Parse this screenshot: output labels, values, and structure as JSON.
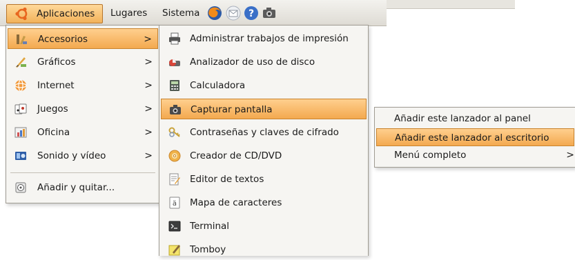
{
  "panel": {
    "menus": [
      {
        "label": "Aplicaciones"
      },
      {
        "label": "Lugares"
      },
      {
        "label": "Sistema"
      }
    ],
    "launchers": [
      "firefox-icon",
      "mail-icon",
      "help-icon",
      "screenshot-icon"
    ]
  },
  "main_menu": {
    "items": [
      {
        "label": "Accesorios",
        "icon": "accessories-icon",
        "arrow": ">"
      },
      {
        "label": "Gráficos",
        "icon": "graphics-icon",
        "arrow": ">"
      },
      {
        "label": "Internet",
        "icon": "internet-icon",
        "arrow": ">"
      },
      {
        "label": "Juegos",
        "icon": "games-icon",
        "arrow": ">"
      },
      {
        "label": "Oficina",
        "icon": "office-icon",
        "arrow": ">"
      },
      {
        "label": "Sonido y vídeo",
        "icon": "sound-video-icon",
        "arrow": ">"
      },
      {
        "label": "Añadir y quitar...",
        "icon": "add-remove-icon"
      }
    ]
  },
  "accessories_menu": {
    "items": [
      {
        "label": "Administrar trabajos de impresión",
        "icon": "printer-icon"
      },
      {
        "label": "Analizador de uso de disco",
        "icon": "disk-usage-icon"
      },
      {
        "label": "Calculadora",
        "icon": "calculator-icon"
      },
      {
        "label": "Capturar pantalla",
        "icon": "camera-icon"
      },
      {
        "label": "Contraseñas y claves de cifrado",
        "icon": "keys-icon"
      },
      {
        "label": "Creador de CD/DVD",
        "icon": "cd-icon"
      },
      {
        "label": "Editor de textos",
        "icon": "text-editor-icon"
      },
      {
        "label": "Mapa de caracteres",
        "icon": "charmap-icon"
      },
      {
        "label": "Terminal",
        "icon": "terminal-icon"
      },
      {
        "label": "Tomboy",
        "icon": "tomboy-icon"
      }
    ]
  },
  "context_menu": {
    "items": [
      {
        "label": "Añadir este lanzador al panel"
      },
      {
        "label": "Añadir este lanzador al escritorio"
      },
      {
        "label": "Menú completo",
        "arrow": ">"
      }
    ]
  },
  "colors": {
    "highlight": "#f3a94f",
    "menu_bg": "#f6f5f2",
    "panel_bg": "#e7e5df"
  }
}
